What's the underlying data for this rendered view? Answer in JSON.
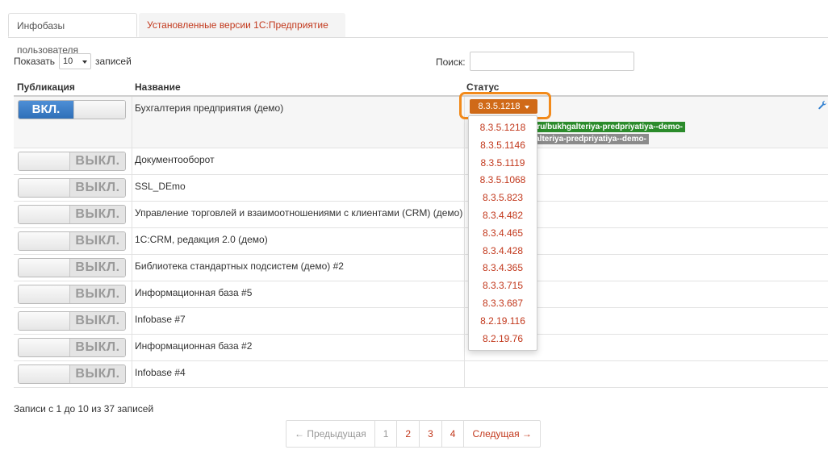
{
  "tabs": [
    {
      "label": "Инфобазы пользователя",
      "active": true
    },
    {
      "label": "Установленные версии 1С:Предприятие",
      "active": false
    }
  ],
  "controls": {
    "show_label": "Показать",
    "page_size": "10",
    "records_label": "записей",
    "search_label": "Поиск:",
    "search_value": ""
  },
  "table": {
    "headers": [
      "Публикация",
      "Название",
      "Статус"
    ],
    "rows": [
      {
        "toggle": "ВКЛ.",
        "name": "Бухгалтерия предприятия (демо)"
      },
      {
        "toggle": "ВЫКЛ.",
        "name": "Документооборот"
      },
      {
        "toggle": "ВЫКЛ.",
        "name": "SSL_DEmo"
      },
      {
        "toggle": "ВЫКЛ.",
        "name": "Управление торговлей и взаимоотношениями с клиентами (CRM) (демо)"
      },
      {
        "toggle": "ВЫКЛ.",
        "name": "1C:CRM, редакция 2.0 (демо)"
      },
      {
        "toggle": "ВЫКЛ.",
        "name": "Библиотека стандартных подсистем (демо) #2"
      },
      {
        "toggle": "ВЫКЛ.",
        "name": "Информационная база #5"
      },
      {
        "toggle": "ВЫКЛ.",
        "name": "Infobase #7"
      },
      {
        "toggle": "ВЫКЛ.",
        "name": "Информационная база #2"
      },
      {
        "toggle": "ВЫКЛ.",
        "name": "Infobase #4"
      }
    ]
  },
  "status": {
    "selected_version": "8.3.5.1218",
    "link_green": "c.ru/bukhgalteriya-predpriyatiya--demo-",
    "link_gray": "galteriya-predpriyatiya--demo-"
  },
  "version_menu": [
    "8.3.5.1218",
    "8.3.5.1146",
    "8.3.5.1119",
    "8.3.5.1068",
    "8.3.5.823",
    "8.3.4.482",
    "8.3.4.465",
    "8.3.4.428",
    "8.3.4.365",
    "8.3.3.715",
    "8.3.3.687",
    "8.2.19.116",
    "8.2.19.76"
  ],
  "footer": {
    "info": "Записи с 1 до 10 из 37 записей",
    "prev": "← Предыдущая",
    "pages": [
      "1",
      "2",
      "3",
      "4"
    ],
    "next": "Следущая →"
  },
  "colors": {
    "accent": "#c2381c",
    "highlight": "#f28a1b",
    "toggle_on": "#2f6fb8",
    "link_green": "#2b8b2b"
  }
}
